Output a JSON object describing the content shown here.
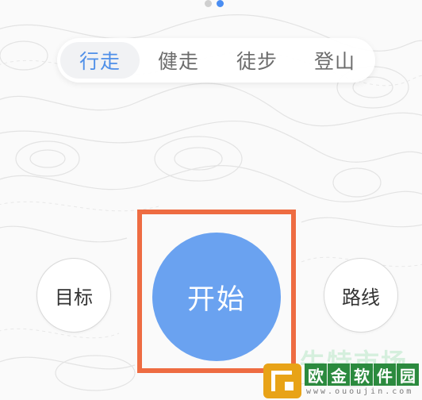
{
  "pager": {
    "total": 2,
    "active_index": 1
  },
  "tabs": [
    {
      "label": "行走",
      "selected": true
    },
    {
      "label": "健走",
      "selected": false
    },
    {
      "label": "徒步",
      "selected": false
    },
    {
      "label": "登山",
      "selected": false
    }
  ],
  "controls": {
    "target_label": "目标",
    "start_label": "开始",
    "route_label": "路线"
  },
  "colors": {
    "accent": "#4f8fe8",
    "start_button": "#6aa2f0",
    "highlight_box": "#ee6c42"
  },
  "watermark": {
    "faint_text": "牛特市场",
    "title_chars": [
      "欧",
      "金",
      "软",
      "件",
      "园"
    ],
    "url": "www.ououjin.com"
  }
}
